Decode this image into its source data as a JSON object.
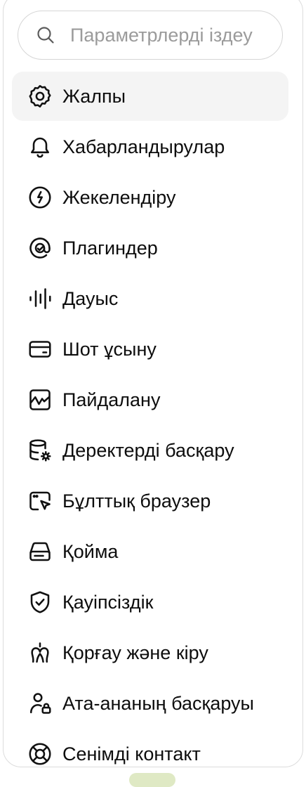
{
  "search": {
    "placeholder": "Параметрлерді іздеу",
    "icon": "search-icon"
  },
  "nav": {
    "active_index": 0,
    "items": [
      {
        "label": "Жалпы",
        "icon": "gear-icon"
      },
      {
        "label": "Хабарландырулар",
        "icon": "bell-icon"
      },
      {
        "label": "Жекелендіру",
        "icon": "personalization-icon"
      },
      {
        "label": "Плагиндер",
        "icon": "plugins-icon"
      },
      {
        "label": "Дауыс",
        "icon": "voice-waveform-icon"
      },
      {
        "label": "Шот ұсыну",
        "icon": "credit-card-icon"
      },
      {
        "label": "Пайдалану",
        "icon": "usage-chart-icon"
      },
      {
        "label": "Деректерді басқару",
        "icon": "database-gear-icon"
      },
      {
        "label": "Бұлттық браузер",
        "icon": "cloud-browser-icon"
      },
      {
        "label": "Қойма",
        "icon": "storage-drive-icon"
      },
      {
        "label": "Қауіпсіздік",
        "icon": "shield-check-icon"
      },
      {
        "label": "Қорғау және кіру",
        "icon": "protection-access-icon"
      },
      {
        "label": "Ата-ананың басқаруы",
        "icon": "parental-controls-icon"
      },
      {
        "label": "Сенімді контакт",
        "icon": "lifebuoy-icon"
      }
    ]
  }
}
